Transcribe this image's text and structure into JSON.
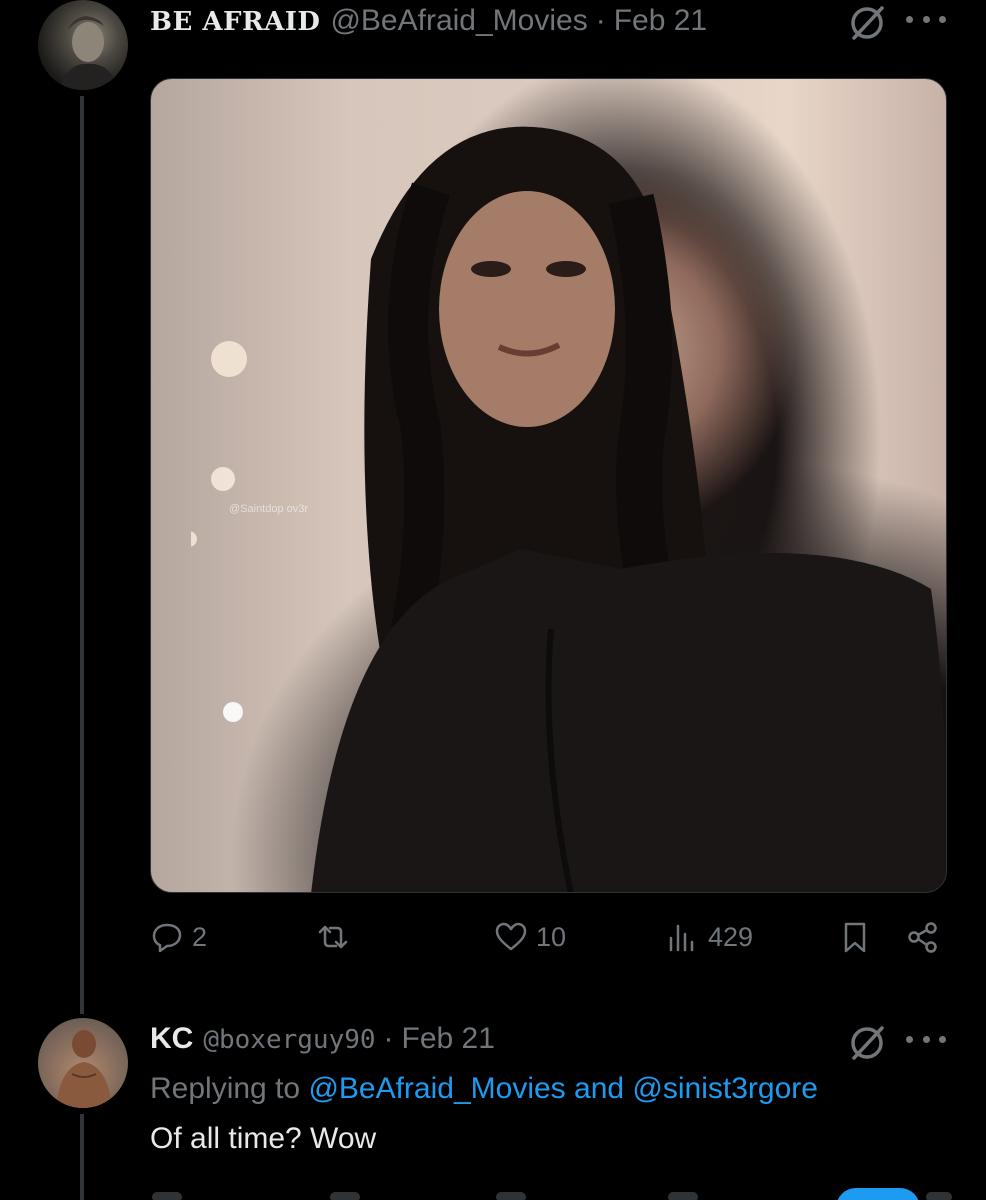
{
  "tweet": {
    "display_name": "BE AFRAID",
    "handle": "@BeAfraid_Movies",
    "separator": "·",
    "date": "Feb 21",
    "media": {
      "watermark": "@Saintdop ov3r"
    },
    "actions": {
      "replies": "2",
      "likes": "10",
      "views": "429"
    }
  },
  "reply": {
    "display_name": "KC",
    "handle": "@boxerguy90",
    "separator": "·",
    "date": "Feb 21",
    "replying_prefix": "Replying to",
    "replying_mention_1": "@BeAfraid_Movies",
    "replying_and": "and",
    "replying_mention_2": "@sinist3rgore",
    "text": "Of all time? Wow"
  },
  "colors": {
    "background": "#000000",
    "primary_text": "#e7e9ea",
    "secondary_text": "#71767b",
    "accent": "#1d9bf0",
    "thread_line": "#333639"
  },
  "icons": {
    "grok": "grok-icon",
    "more": "more-icon",
    "reply": "reply-icon",
    "retweet": "retweet-icon",
    "like": "heart-icon",
    "views": "views-icon",
    "bookmark": "bookmark-icon",
    "share": "share-icon"
  }
}
